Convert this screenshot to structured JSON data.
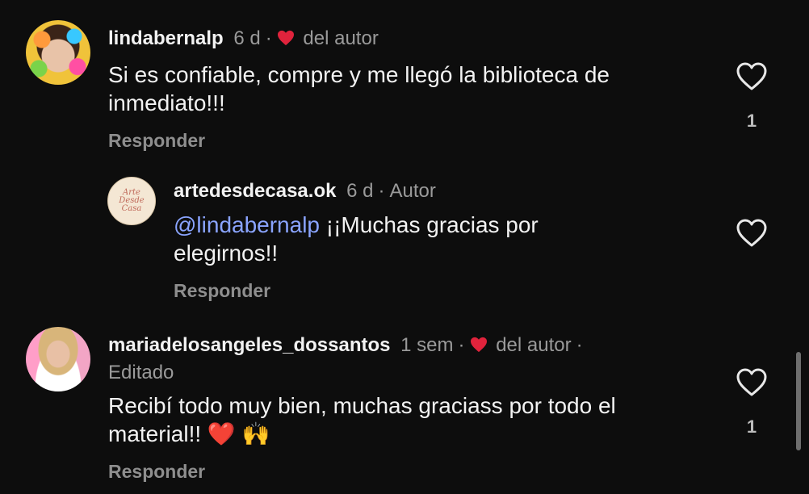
{
  "comments": [
    {
      "username": "lindabernalp",
      "time": "6 d",
      "author_badge": "del autor",
      "text": "Si es confiable, compre y me llegó la biblioteca de inmediato!!!",
      "reply_label": "Responder",
      "likes": "1"
    },
    {
      "username": "artedesdecasa.ok",
      "time": "6 d",
      "role": "Autor",
      "mention": "@lindabernalp",
      "text": " ¡¡Muchas gracias por elegirnos!!",
      "reply_label": "Responder",
      "avatar_text": "Arte Desde Casa"
    },
    {
      "username": "mariadelosangeles_dossantos",
      "time": "1 sem",
      "author_badge": "del autor",
      "edited": "Editado",
      "text": "Recibí todo muy bien, muchas graciass por todo el material!! ❤️ 🙌",
      "reply_label": "Responder",
      "likes": "1"
    }
  ],
  "colors": {
    "background": "#0d0d0d",
    "heart_red": "#e0233c",
    "mention_blue": "#8aa4ff",
    "meta_gray": "#9a9a9a"
  },
  "icons": [
    "heart-outline-icon",
    "heart-filled-icon"
  ]
}
